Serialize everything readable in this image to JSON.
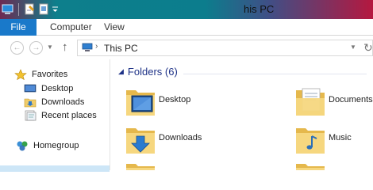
{
  "window": {
    "title": "his PC"
  },
  "ribbon": {
    "tabs": [
      "File",
      "Computer",
      "View"
    ]
  },
  "address_bar": {
    "path": [
      "This PC"
    ]
  },
  "nav_pane": {
    "favorites_label": "Favorites",
    "favorites_items": [
      "Desktop",
      "Downloads",
      "Recent places"
    ],
    "homegroup_label": "Homegroup"
  },
  "content": {
    "group_title": "Folders (6)",
    "folders": [
      "Desktop",
      "Documents",
      "Downloads",
      "Music"
    ]
  },
  "colors": {
    "file_tab": "#1979ca",
    "group_header": "#1e3287",
    "folder_yellow": "#f3d27a",
    "selection_blue": "#cde6f7"
  }
}
